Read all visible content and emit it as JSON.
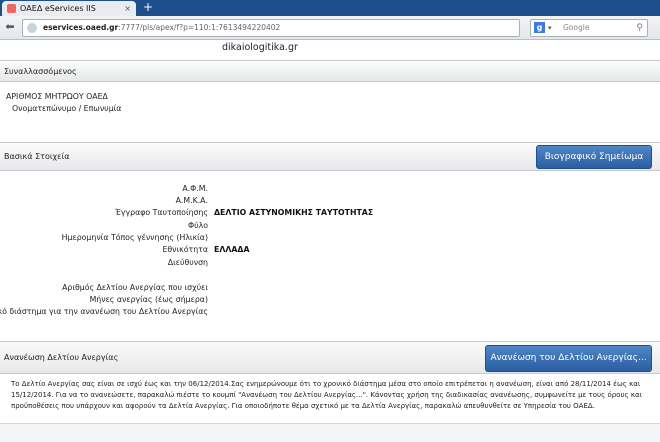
{
  "browser": {
    "tab_title": "ΟΑΕΔ eServices IIS",
    "new_tab": "+",
    "url_host": "eservices.oaed.gr",
    "url_path": ":7777/pls/apex/f?p=110:1:7613494220402",
    "search_placeholder": "Google",
    "search_engine_letter": "g"
  },
  "watermark": "dikaiologitika.gr",
  "section_counterparty": {
    "title": "Συναλλασσόμενος",
    "labels": {
      "registry_number": "ΑΡΙΘΜΟΣ ΜΗΤΡΩΟΥ ΟΑΕΔ",
      "full_name": "Ονοματεπώνυμο / Επωνυμία"
    }
  },
  "section_basic": {
    "title": "Βασικά Στοιχεία",
    "cv_button": "Βιογραφικό Σημείωμα",
    "rows": [
      {
        "label": "Α.Φ.Μ.",
        "value": ""
      },
      {
        "label": "Α.Μ.Κ.Α.",
        "value": ""
      },
      {
        "label": "Έγγραφο Ταυτοποίησης",
        "value": "ΔΕΛΤΙΟ ΑΣΤΥΝΟΜΙΚΗΣ ΤΑΥΤΟΤΗΤΑΣ"
      },
      {
        "label": "Φύλο",
        "value": ""
      },
      {
        "label": "Ημερομηνία Τόπος γέννησης (Ηλικία)",
        "value": ""
      },
      {
        "label": "Εθνικότητα",
        "value": "ΕΛΛΑΔΑ"
      },
      {
        "label": "Διεύθυνση",
        "value": ""
      },
      {
        "label": "Αριθμός Δελτίου Ανεργίας που ισχύει",
        "value": ""
      },
      {
        "label": "Μήνες ανεργίας (έως σήμερα)",
        "value": ""
      },
      {
        "label": "Χρονικό διάστημα για την ανανέωση του Δελτίου Ανεργίας",
        "value": ""
      }
    ]
  },
  "section_renewal": {
    "title": "Ανανέωση Δελτίου Ανεργίας",
    "renew_button": "Ανανέωση του Δελτίου Ανεργίας...",
    "notice": "Το Δελτίο Ανεργίας σας είναι σε ισχύ έως και την 06/12/2014.Σας ενημερώνουμε ότι το χρονικό διάστημα μέσα στο οποίο επιτρέπεται η ανανέωση, είναι από 28/11/2014 έως και 15/12/2014. Για να το ανανεώσετε, παρακαλώ πιέστε το κουμπί \"Ανανέωση του Δελτίου Ανεργίας...\". Κάνοντας χρήση της διαδικασίας ανανέωσης, συμφωνείτε με τους όρους και προϋποθέσεις που υπάρχουν και αφορούν τα Δελτία Ανεργίας. Για οποιοδήποτε θέμα σχετικό με τα Δελτία Ανεργίας, παρακαλώ απευθυνθείτε σε Υπηρεσία του ΟΑΕΔ."
  },
  "colors": {
    "accent": "#2b5ea1",
    "tabbar": "#1e4e8c"
  }
}
